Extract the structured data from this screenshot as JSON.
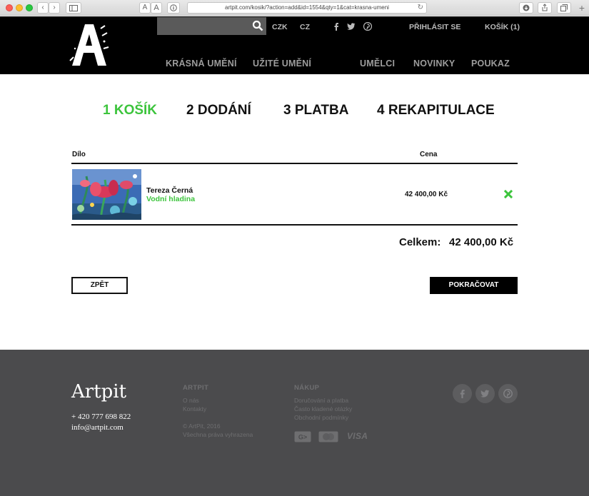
{
  "browser": {
    "url": "artpit.com/kosik/?action=add&id=1554&qty=1&cat=krasna-umeni",
    "text_size_small": "A",
    "text_size_large": "A"
  },
  "header": {
    "currency_czk": "CZK",
    "language_cz": "CZ",
    "login": "PŘIHLÁSIT SE",
    "cart": "KOŠÍK (1)",
    "nav": {
      "fine_art": "KRÁSNÁ UMĚNÍ",
      "applied_art": "UŽITÉ UMĚNÍ",
      "artists": "UMĚLCI",
      "news": "NOVINKY",
      "voucher": "POUKAZ"
    }
  },
  "steps": [
    {
      "label": "1 KOŠÍK",
      "active": true
    },
    {
      "label": "2 DODÁNÍ",
      "active": false
    },
    {
      "label": "3 PLATBA",
      "active": false
    },
    {
      "label": "4 REKAPITULACE",
      "active": false
    }
  ],
  "cart": {
    "col_work": "Dílo",
    "col_price": "Cena",
    "item": {
      "artist": "Tereza Černá",
      "title": "Vodní hladina",
      "price": "42 400,00 Kč"
    },
    "total_label": "Celkem:",
    "total_value": "42 400,00 Kč",
    "back_button": "ZPĚT",
    "continue_button": "POKRAČOVAT"
  },
  "footer": {
    "brand": "Artpit",
    "phone": "+ 420 777 698 822",
    "email": "info@artpit.com",
    "artpit_heading": "ARTPIT",
    "artpit_links": [
      "O nás",
      "Kontakty"
    ],
    "copyright": "© ArtPit, 2016",
    "rights": "Všechna práva vyhrazena",
    "shop_heading": "NÁKUP",
    "shop_links": [
      "Doručování a platba",
      "Často kladené otázky",
      "Obchodní podmínky"
    ],
    "payment_visa": "VISA"
  },
  "colors": {
    "accent": "#3cc43c",
    "header_bg": "#000000",
    "footer_bg": "#4b4b4d"
  }
}
